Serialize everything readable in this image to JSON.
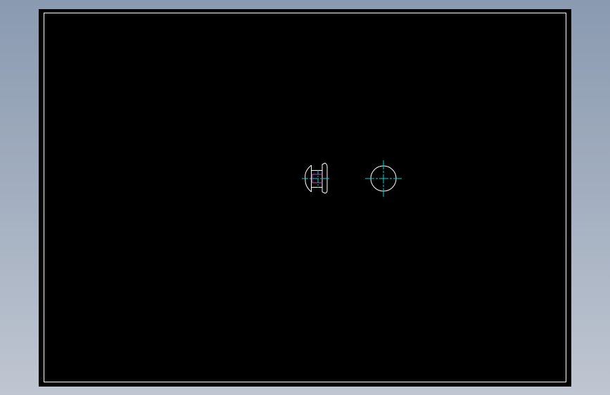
{
  "drawing": {
    "background_color": "#000000",
    "border_color": "#ffffff",
    "outline_color": "#ffffff",
    "centerline_color": "#00d4d4",
    "hidden_line_color": "#d040d0",
    "views": [
      "side-view",
      "end-view"
    ]
  }
}
